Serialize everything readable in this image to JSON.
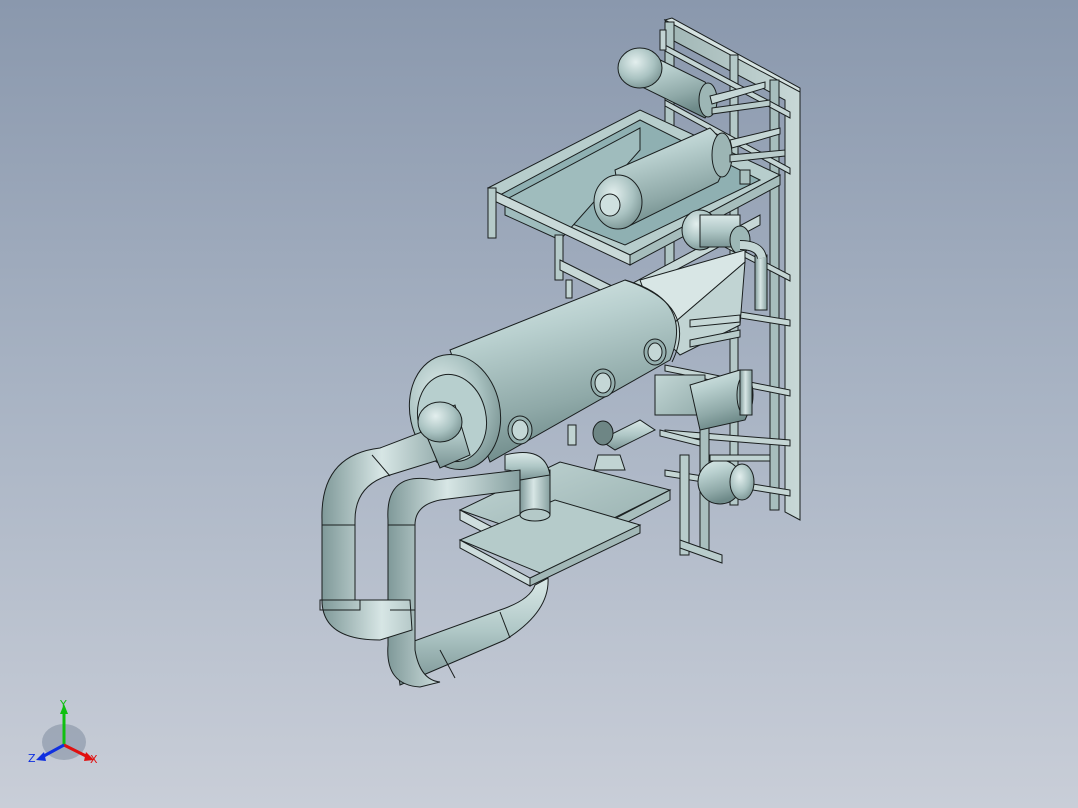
{
  "viewport": {
    "background_top": "#8a98ad",
    "background_bottom": "#c9ced8",
    "model_tint": "#a8c4c4",
    "edge_color": "#1a1f1f"
  },
  "triad": {
    "x_label": "X",
    "y_label": "Y",
    "z_label": "Z",
    "x_color": "#e01010",
    "y_color": "#10c010",
    "z_color": "#1030e0",
    "icon": "coordinate-triad-icon"
  }
}
